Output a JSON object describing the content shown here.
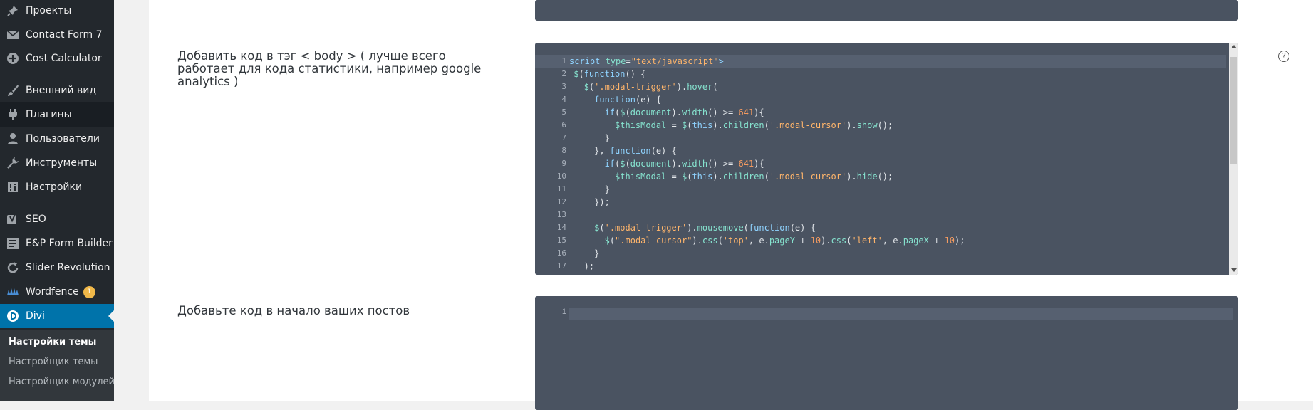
{
  "sidebar": {
    "items": [
      {
        "label": "Проекты",
        "icon": "pin-icon"
      },
      {
        "label": "Contact Form 7",
        "icon": "mail-icon"
      },
      {
        "label": "Cost Calculator",
        "icon": "plus-circle-icon"
      },
      {
        "label": "Внешний вид",
        "icon": "paintbrush-icon"
      },
      {
        "label": "Плагины",
        "icon": "plug-icon"
      },
      {
        "label": "Пользователи",
        "icon": "user-icon"
      },
      {
        "label": "Инструменты",
        "icon": "wrench-icon"
      },
      {
        "label": "Настройки",
        "icon": "settings-icon"
      },
      {
        "label": "SEO",
        "icon": "yoast-icon"
      },
      {
        "label": "E&P Form Builder",
        "icon": "form-icon"
      },
      {
        "label": "Slider Revolution",
        "icon": "refresh-icon"
      },
      {
        "label": "Wordfence",
        "icon": "wordfence-icon",
        "badge": "1"
      },
      {
        "label": "Divi",
        "icon": "divi-icon"
      }
    ],
    "submenu": [
      {
        "label": "Настройки темы"
      },
      {
        "label": "Настройщик темы"
      },
      {
        "label": "Настройщик модулей"
      }
    ]
  },
  "fields": {
    "body_code_label": "Добавить код в тэг < body > ( лучше всего работает для кода статистики, например google analytics )",
    "posts_top_label": "Добавьте код в начало ваших постов",
    "help_symbol": "?"
  },
  "editor_main": {
    "lines": [
      "1",
      "2",
      "3",
      "4",
      "5",
      "6",
      "7",
      "8",
      "9",
      "10",
      "11",
      "12",
      "13",
      "14",
      "15",
      "16",
      "17"
    ]
  },
  "editor_bottom": {
    "line_number": "1"
  },
  "colors": {
    "sidebar_bg": "#23282d",
    "active_bg": "#0073aa",
    "editor_bg": "#4a5361",
    "badge": "#f0b849"
  }
}
